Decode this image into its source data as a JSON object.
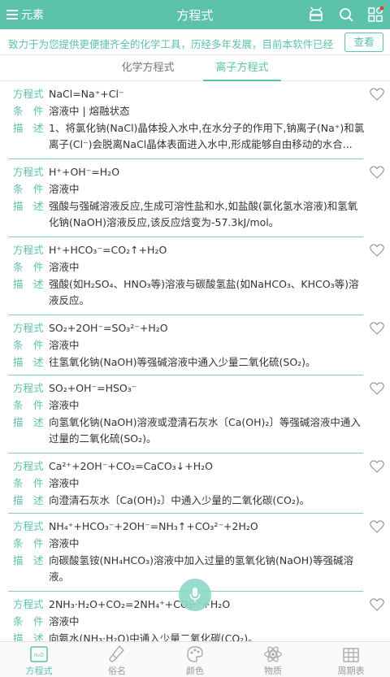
{
  "header": {
    "menu_label": "元素",
    "title": "方程式"
  },
  "notice": {
    "text": "致力于为您提供更便捷齐全的化学工具，历经多年发展，目前本软件已经",
    "button": "查看"
  },
  "tabs": [
    {
      "label": "化学方程式",
      "active": false
    },
    {
      "label": "离子方程式",
      "active": true
    }
  ],
  "labels": {
    "equation": "方程式",
    "condition": "条　件",
    "description": "描　述"
  },
  "items": [
    {
      "equation": "NaCl=Na⁺+Cl⁻",
      "condition": "溶液中 | 熔融状态",
      "description": "1、将氯化钠(NaCl)晶体投入水中,在水分子的作用下,钠离子(Na⁺)和氯离子(Cl⁻)会脱离NaCl晶体表面进入水中,形成能够自由移动的水合..."
    },
    {
      "equation": "H⁺+OH⁻=H₂O",
      "condition": "溶液中",
      "description": "强酸与强碱溶液反应,生成可溶性盐和水,如盐酸(氯化氢水溶液)和氢氧化钠(NaOH)溶液反应,该反应焓变为-57.3kJ/mol。"
    },
    {
      "equation": "H⁺+HCO₃⁻=CO₂↑+H₂O",
      "condition": "溶液中",
      "description": "强酸(如H₂SO₄、HNO₃等)溶液与碳酸氢盐(如NaHCO₃、KHCO₃等)溶液反应。"
    },
    {
      "equation": "SO₂+2OH⁻=SO₃²⁻+H₂O",
      "condition": "溶液中",
      "description": "往氢氧化钠(NaOH)等强碱溶液中通入少量二氧化硫(SO₂)。"
    },
    {
      "equation": "SO₂+OH⁻=HSO₃⁻",
      "condition": "溶液中",
      "description": "向氢氧化钠(NaOH)溶液或澄清石灰水〔Ca(OH)₂〕等强碱溶液中通入过量的二氧化硫(SO₂)。"
    },
    {
      "equation": "Ca²⁺+2OH⁻+CO₂=CaCO₃↓+H₂O",
      "condition": "溶液中",
      "description": "向澄清石灰水〔Ca(OH)₂〕中通入少量的二氧化碳(CO₂)。"
    },
    {
      "equation": "NH₄⁺+HCO₃⁻+2OH⁻=NH₃↑+CO₃²⁻+2H₂O",
      "condition": "溶液中",
      "description": "向碳酸氢铵(NH₄HCO₃)溶液中加入过量的氢氧化钠(NaOH)等强碱溶液。"
    },
    {
      "equation": "2NH₃·H₂O+CO₂=2NH₄⁺+CO₃²⁻+H₂O",
      "condition": "溶液中",
      "description": "向氨水(NH₃·H₂O)中通入少量二氧化碳(CO₂)。"
    }
  ],
  "bottom_nav": [
    {
      "label": "方程式",
      "icon": "equation-icon",
      "active": true
    },
    {
      "label": "俗名",
      "icon": "flask-icon",
      "active": false
    },
    {
      "label": "颜色",
      "icon": "palette-icon",
      "active": false
    },
    {
      "label": "物质",
      "icon": "atom-icon",
      "active": false
    },
    {
      "label": "周期表",
      "icon": "table-icon",
      "active": false
    }
  ],
  "colors": {
    "accent": "#5cc2ac",
    "separator": "#7ccfc0"
  }
}
